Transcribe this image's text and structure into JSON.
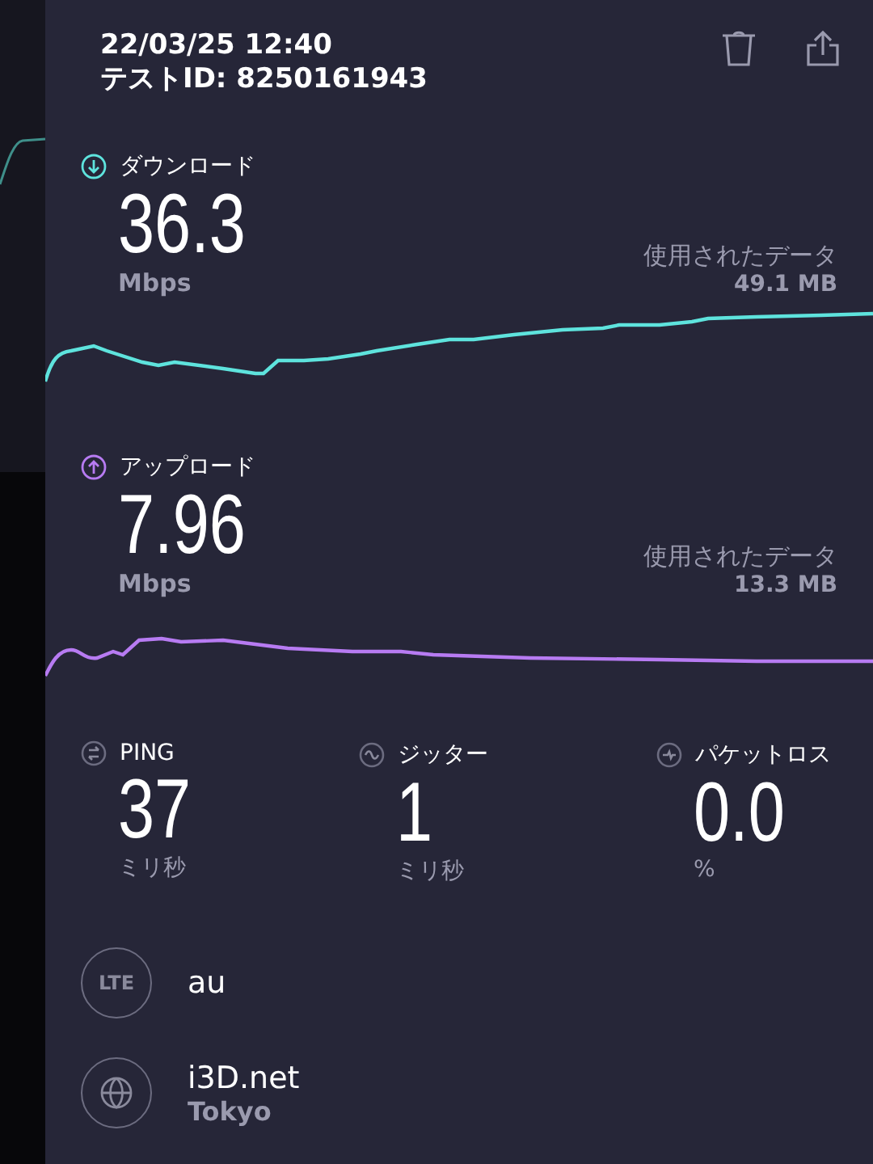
{
  "header": {
    "datetime": "22/03/25 12:40",
    "test_id": "テストID: 8250161943"
  },
  "results": [
    {
      "kind": "download",
      "label": "ダウンロード",
      "value": "36.3",
      "unit": "Mbps",
      "data_label": "使用されたデータ",
      "data_value": "49.1 MB",
      "color": "#5ee3dd"
    },
    {
      "kind": "upload",
      "label": "アップロード",
      "value": "7.96",
      "unit": "Mbps",
      "data_label": "使用されたデータ",
      "data_value": "13.3 MB",
      "color": "#b77bf2"
    }
  ],
  "metrics": [
    {
      "kind": "ping",
      "label": "PING",
      "value": "37",
      "unit": "ミリ秒"
    },
    {
      "kind": "jitter",
      "label": "ジッター",
      "value": "1",
      "unit": "ミリ秒"
    },
    {
      "kind": "loss",
      "label": "パケットロス",
      "value": "0.0",
      "unit": "%"
    }
  ],
  "provider": {
    "badge": "LTE",
    "name": "au"
  },
  "server": {
    "name": "i3D.net",
    "location": "Tokyo"
  }
}
